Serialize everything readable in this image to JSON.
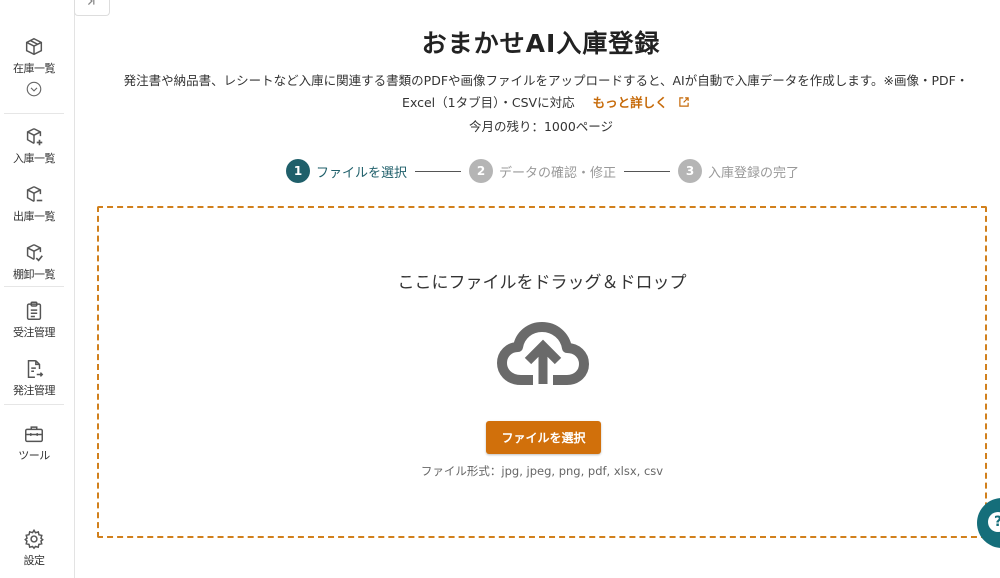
{
  "sidebar": {
    "collapse_icon": "collapse-arrow-icon",
    "items": [
      {
        "label": "在庫一覧",
        "icon": "box-icon"
      },
      {
        "label": "入庫一覧",
        "icon": "box-plus-icon"
      },
      {
        "label": "出庫一覧",
        "icon": "box-minus-icon"
      },
      {
        "label": "棚卸一覧",
        "icon": "box-check-icon"
      },
      {
        "label": "受注管理",
        "icon": "clipboard-icon"
      },
      {
        "label": "発注管理",
        "icon": "document-arrow-icon"
      },
      {
        "label": "ツール",
        "icon": "toolbox-icon"
      },
      {
        "label": "設定",
        "icon": "gear-icon"
      }
    ]
  },
  "header": {
    "title": "おまかせAI入庫登録",
    "description_line1": "発注書や納品書、レシートなど入庫に関連する書類のPDFや画像ファイルをアップロードすると、AIが自動で入庫データを作成します。※画像・PDF・",
    "description_line2": "Excel（1タブ目）・CSVに対応",
    "more_link": "もっと詳しく",
    "remaining": "今月の残り：1000ページ"
  },
  "stepper": {
    "steps": [
      {
        "num": "1",
        "label": "ファイルを選択",
        "state": "active"
      },
      {
        "num": "2",
        "label": "データの確認・修正",
        "state": "inactive"
      },
      {
        "num": "3",
        "label": "入庫登録の完了",
        "state": "inactive"
      }
    ]
  },
  "dropzone": {
    "title": "ここにファイルをドラッグ＆ドロップ",
    "button_label": "ファイルを選択",
    "formats": "ファイル形式：jpg, jpeg, png, pdf, xlsx, csv"
  },
  "help": {
    "icon": "help-icon",
    "glyph": "?"
  },
  "colors": {
    "accent": "#d1700b",
    "dash": "#d1801c",
    "step_active": "#1f5f6a",
    "step_inactive": "#b5b5b5",
    "help": "#156e7a"
  }
}
